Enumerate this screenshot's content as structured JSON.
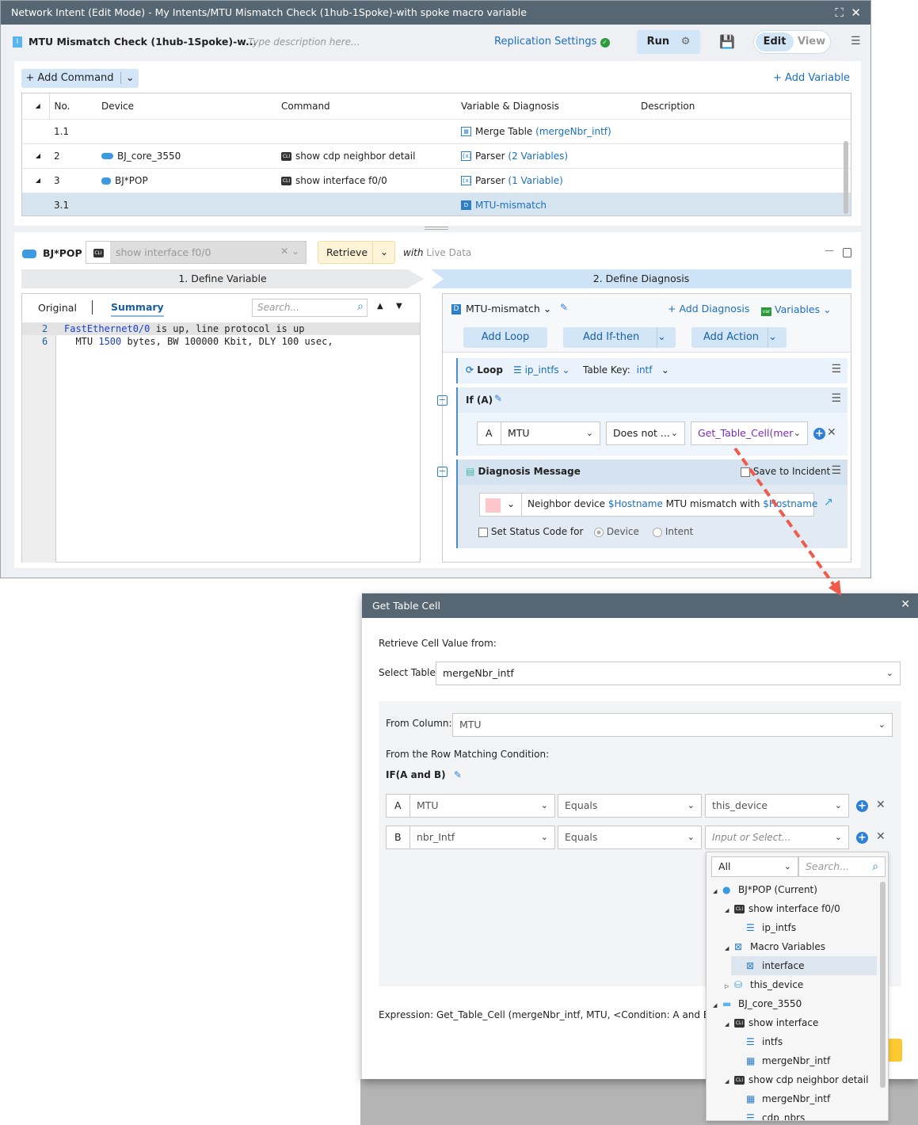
{
  "window": {
    "title": "Network Intent (Edit Mode) - My Intents/MTU Mismatch Check (1hub-1Spoke)-with spoke macro variable"
  },
  "toolbar": {
    "intent_name": "MTU Mismatch Check (1hub-1Spoke)-w...",
    "description_placeholder": "Type description here...",
    "replication": "Replication Settings",
    "run": "Run",
    "edit": "Edit",
    "view": "View"
  },
  "commands": {
    "add_command": "+ Add Command",
    "add_variable": "+ Add Variable",
    "columns": [
      "No.",
      "Device",
      "Command",
      "Variable & Diagnosis",
      "Description"
    ],
    "rows": [
      {
        "no": "1.1",
        "device": "",
        "command": "",
        "var_label": "Merge Table",
        "var_link": "(mergeNbr_intf)"
      },
      {
        "no": "2",
        "device": "BJ_core_3550",
        "command": "show cdp neighbor detail",
        "var_label": "Parser",
        "var_link": "(2 Variables)"
      },
      {
        "no": "3",
        "device": "BJ*POP",
        "command": "show interface f0/0",
        "var_label": "Parser",
        "var_link": "(1 Variable)"
      },
      {
        "no": "3.1",
        "device": "",
        "command": "",
        "var_label": "",
        "var_link": "MTU-mismatch"
      }
    ]
  },
  "editor": {
    "device": "BJ*POP",
    "command": "show interface f0/0",
    "retrieve": "Retrieve",
    "with": "with",
    "live_data": "Live Data",
    "step1": "1. Define Variable",
    "step2": "2. Define Diagnosis",
    "tab_original": "Original",
    "tab_summary": "Summary",
    "search_placeholder": "Search...",
    "lines": [
      {
        "num": "2",
        "iface": "FastEthernet0/0",
        "rest": " is up, line protocol is up"
      },
      {
        "num": "6",
        "pre": "  MTU ",
        "val": "1500",
        "rest": " bytes, BW 100000 Kbit, DLY 100 usec,"
      }
    ]
  },
  "diagnosis": {
    "name": "MTU-mismatch",
    "add_diagnosis": "+ Add Diagnosis",
    "variables": "Variables",
    "add_loop": "Add Loop",
    "add_ifthen": "Add If-then",
    "add_action": "Add Action",
    "loop": "Loop",
    "loop_var": "ip_intfs",
    "table_key_label": "Table Key:",
    "table_key": "intf",
    "if_label": "If (A)",
    "cond": {
      "letter": "A",
      "left": "MTU",
      "op": "Does not ...",
      "right": "Get_Table_Cell(merg"
    },
    "message_title": "Diagnosis Message",
    "save_incident": "Save to Incident",
    "message": {
      "p1": "Neighbor device ",
      "v1": "$Hostname",
      "p2": " MTU mismatch with ",
      "v2": "$Hostname"
    },
    "status_code": "Set Status Code for",
    "radio_device": "Device",
    "radio_intent": "Intent",
    "severity_color": "#ffc7cc"
  },
  "dialog": {
    "title": "Get Table Cell",
    "retrieve_from": "Retrieve Cell Value from:",
    "select_table_label": "Select Table:",
    "select_table": "mergeNbr_intf",
    "from_column_label": "From Column:",
    "from_column": "MTU",
    "row_condition": "From the Row Matching Condition:",
    "if_label": "IF(A and B)",
    "conditions": [
      {
        "letter": "A",
        "left": "MTU",
        "op": "Equals",
        "right": "this_device",
        "placeholder": ""
      },
      {
        "letter": "B",
        "left": "nbr_Intf",
        "op": "Equals",
        "right": "",
        "placeholder": "Input or Select..."
      }
    ],
    "expression": "Expression: Get_Table_Cell (mergeNbr_intf, MTU, <Condition: A and B>)"
  },
  "picker": {
    "filter": "All",
    "search_placeholder": "Search...",
    "items": [
      {
        "label": "BJ*POP (Current)",
        "icon": "router-icon",
        "depth": 0,
        "toggle": "◢"
      },
      {
        "label": "show interface f0/0",
        "icon": "cli-icon",
        "depth": 1,
        "toggle": "◢"
      },
      {
        "label": "ip_intfs",
        "icon": "list-icon",
        "depth": 2,
        "toggle": ""
      },
      {
        "label": "Macro Variables",
        "icon": "macro-icon",
        "depth": 1,
        "toggle": "◢"
      },
      {
        "label": "interface",
        "icon": "macro-icon",
        "depth": 2,
        "toggle": "",
        "selected": true
      },
      {
        "label": "this_device",
        "icon": "device-db-icon",
        "depth": 1,
        "toggle": "▷"
      },
      {
        "label": "BJ_core_3550",
        "icon": "switch-icon",
        "depth": 0,
        "toggle": "◢"
      },
      {
        "label": "show interface",
        "icon": "cli-icon",
        "depth": 1,
        "toggle": "◢"
      },
      {
        "label": "intfs",
        "icon": "list-icon",
        "depth": 2,
        "toggle": ""
      },
      {
        "label": "mergeNbr_intf",
        "icon": "merge-table-icon",
        "depth": 2,
        "toggle": ""
      },
      {
        "label": "show cdp neighbor detail",
        "icon": "cli-icon",
        "depth": 1,
        "toggle": "◢"
      },
      {
        "label": "mergeNbr_intf",
        "icon": "table-icon",
        "depth": 2,
        "toggle": ""
      },
      {
        "label": "cdp_nbrs",
        "icon": "list-icon",
        "depth": 2,
        "toggle": ""
      }
    ]
  },
  "colors": {
    "titlebar": "#566773",
    "accent": "#1a6fc0",
    "arrow": "#f05a4a"
  }
}
